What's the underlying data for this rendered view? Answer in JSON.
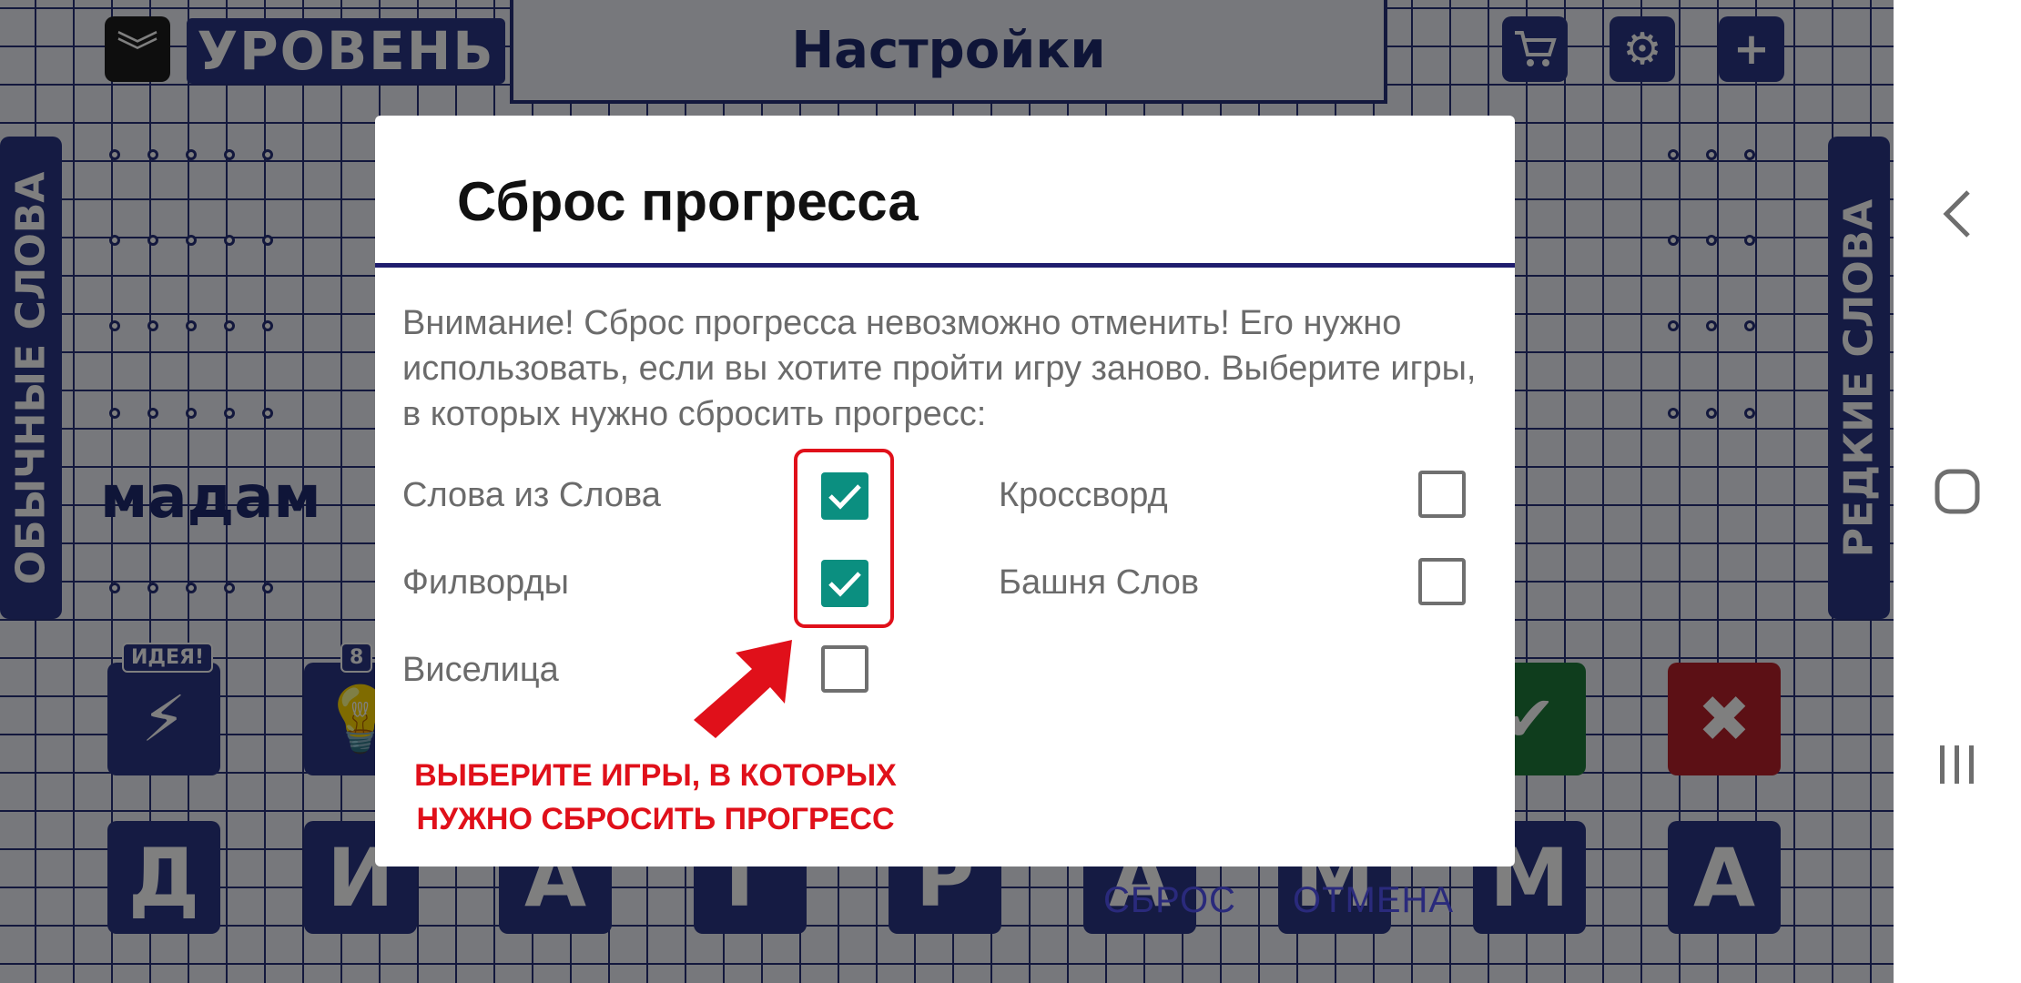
{
  "game": {
    "level_label": "УРОВЕНЬ",
    "screen_title": "Настройки",
    "left_tab": "ОБЫЧНЫЕ СЛОВА",
    "right_tab": "РЕДКИЕ СЛОВА",
    "found_word": "мадам",
    "hint_badges": [
      "ИДЕЯ!",
      "8"
    ],
    "letters": [
      "Д",
      "И",
      "А",
      "Г",
      "Р",
      "А",
      "М",
      "М",
      "А"
    ]
  },
  "dialog": {
    "title": "Сброс прогресса",
    "message": "Внимание! Сброс прогресса невозможно отменить! Его нужно использовать, если вы хотите пройти игру заново. Выберите игры, в которых нужно сбросить прогресс:",
    "options": [
      {
        "label": "Слова из Слова",
        "checked": true
      },
      {
        "label": "Кроссворд",
        "checked": false
      },
      {
        "label": "Филворды",
        "checked": true
      },
      {
        "label": "Башня Слов",
        "checked": false
      },
      {
        "label": "Виселица",
        "checked": false
      }
    ],
    "reset_button": "СБРОС",
    "cancel_button": "ОТМЕНА"
  },
  "annotation": {
    "line1": "ВЫБЕРИТЕ ИГРЫ, В КОТОРЫХ",
    "line2": "НУЖНО СБРОСИТЬ ПРОГРЕСС",
    "color": "#e0101a"
  },
  "colors": {
    "accent": "#1f1d6e",
    "checkbox_checked": "#0b8f80",
    "button_text": "#2a2a7c"
  }
}
